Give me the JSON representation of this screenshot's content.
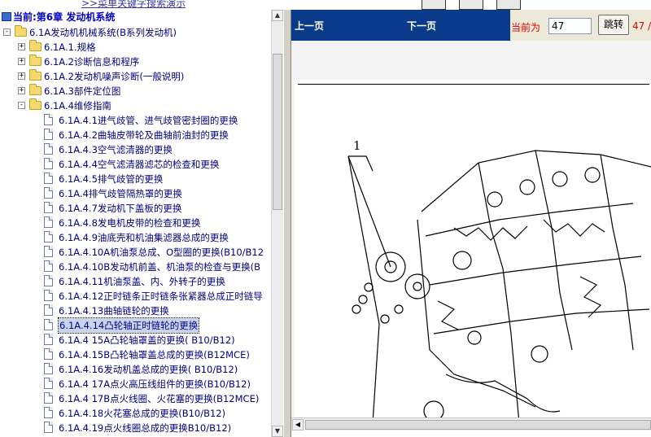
{
  "top_link": ">>菜单关键字搜索演示",
  "tree": {
    "chapter_title": "当前:第6章  发动机系统",
    "items": [
      {
        "label": "6.1A发动机机械系统(B系列发动机)",
        "type": "folder",
        "level": 0,
        "expand": "-"
      },
      {
        "label": "6.1A.1.规格",
        "type": "folder",
        "level": 1,
        "expand": "+"
      },
      {
        "label": "6.1A.2诊断信息和程序",
        "type": "folder",
        "level": 1,
        "expand": "+"
      },
      {
        "label": "6.1A.2发动机噪声诊断(一般说明)",
        "type": "folder",
        "level": 1,
        "expand": "+"
      },
      {
        "label": "6.1A.3部件定位图",
        "type": "folder",
        "level": 1,
        "expand": "+"
      },
      {
        "label": "6.1A.4维修指南",
        "type": "folder",
        "level": 1,
        "expand": "-"
      },
      {
        "label": "6.1A.4.1进气歧管、进气歧管密封圈的更换",
        "type": "doc",
        "level": 2
      },
      {
        "label": "6.1A.4.2曲轴皮带轮及曲轴前油封的更换",
        "type": "doc",
        "level": 2
      },
      {
        "label": "6.1A.4.3空气滤清器的更换",
        "type": "doc",
        "level": 2
      },
      {
        "label": "6.1A.4.4空气滤清器滤芯的检查和更换",
        "type": "doc",
        "level": 2
      },
      {
        "label": "6.1A.4.5排气歧管的更换",
        "type": "doc",
        "level": 2
      },
      {
        "label": "6.1A.4排气歧管隔热罩的更换",
        "type": "doc",
        "level": 2
      },
      {
        "label": "6.1A.4.7发动机下盖板的更换",
        "type": "doc",
        "level": 2
      },
      {
        "label": "6.1A.4.8发电机皮带的检查和更换",
        "type": "doc",
        "level": 2
      },
      {
        "label": "6.1A.4.9油底壳和机油集滤器总成的更换",
        "type": "doc",
        "level": 2
      },
      {
        "label": "6.1A.4.10A机油泵总成、O型圈的更换(B10/B12",
        "type": "doc",
        "level": 2
      },
      {
        "label": "6.1A.4.10B发动机前盖、机油泵的检查与更换(B",
        "type": "doc",
        "level": 2
      },
      {
        "label": "6.1A.4.11机油泵盖、内、外转子的更换",
        "type": "doc",
        "level": 2
      },
      {
        "label": "6.1A.4.12正时链条正时链条张紧器总成正时链导",
        "type": "doc",
        "level": 2
      },
      {
        "label": "6.1A.4.13曲轴链轮的更换",
        "type": "doc",
        "level": 2
      },
      {
        "label": "6.1A.4.14凸轮轴正时链轮的更换",
        "type": "doc",
        "level": 2,
        "selected": true
      },
      {
        "label": "6.1A.4 15A凸轮轴罩盖的更换( B10/B12)",
        "type": "doc",
        "level": 2
      },
      {
        "label": "6.1A.4.15B凸轮轴罩盖总成的更换(B12MCE)",
        "type": "doc",
        "level": 2
      },
      {
        "label": "6.1A.4.16发动机盖总成的更换( B10/B12)",
        "type": "doc",
        "level": 2
      },
      {
        "label": "6.1A.4 17A点火高压线组件的更换(B10/B12)",
        "type": "doc",
        "level": 2
      },
      {
        "label": "6.1A.4 17B点火线圈、火花塞的更换(B12MCE)",
        "type": "doc",
        "level": 2
      },
      {
        "label": "6.1A.4.18火花塞总成的更换(B10/B12)",
        "type": "doc",
        "level": 2
      },
      {
        "label": "6.1A.4.19点火线圈总成的更换B10/B12)",
        "type": "doc",
        "level": 2
      }
    ]
  },
  "viewer": {
    "prev_label": "上一页",
    "next_label": "下一页",
    "current_label": "当前为",
    "page_value": "47",
    "jump_label": "跳转",
    "total_text": "47 /",
    "callout_number": "1"
  },
  "colors": {
    "toolbar_bg": "#0a3a8a",
    "tree_text": "#000080",
    "chapter_text": "#0000cc",
    "page_label_red": "#e00000"
  }
}
